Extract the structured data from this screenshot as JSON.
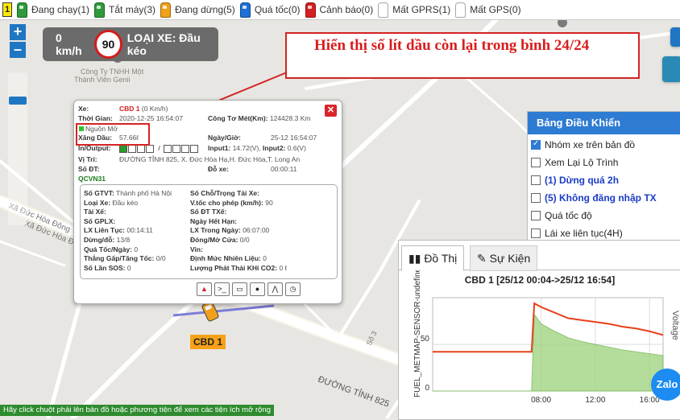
{
  "status_bar": {
    "badge": "1",
    "items": [
      {
        "label": "Đang chạy(1)",
        "color": "#2e9a3c"
      },
      {
        "label": "Tắt máy(3)",
        "color": "#2e9a3c"
      },
      {
        "label": "Đang dừng(5)",
        "color": "#f0a019"
      },
      {
        "label": "Quá tốc(0)",
        "color": "#1e6fd6"
      },
      {
        "label": "Cảnh báo(0)",
        "color": "#d42020"
      },
      {
        "label": "Mất GPRS(1)",
        "color": "#ffffff"
      },
      {
        "label": "Mất GPS(0)",
        "color": "#ffffff"
      }
    ]
  },
  "zoom": {
    "plus": "+",
    "minus": "–"
  },
  "speed_panel": {
    "speed": "0 km/h",
    "limit": "90",
    "vehicle_type": "LOẠI XE: Đầu kéo"
  },
  "annotation": "Hiển thị số lít dầu còn lại trong bình 24/24",
  "map_labels": {
    "company": "Công Ty TNHH Một Thành Viên Genii International",
    "road_1": "ĐƯỜNG TỈNH 825",
    "road_2": "Xã Đức Hòa Đông",
    "road_3": "Xã Đức Hòa Đông",
    "road_4": "Số 3",
    "road_5": "Tỉnh 825",
    "vehicle_label": "CBD 1"
  },
  "popup": {
    "xe_label": "Xe:",
    "xe_value": "CBD 1",
    "speed_value": "(0 Km/h)",
    "thoi_gian_label": "Thời Gian:",
    "thoi_gian_value": "2020-12-25 16:54:07",
    "cong_to_label": "Công Tơ Mét(Km):",
    "cong_to_value": "124428.3 Km",
    "nguon_label": "Nguồn Mở",
    "ngay_gio_label": "Ngày/Giờ:",
    "ngay_gio_value": "25-12 16:54:07",
    "xang_dau_label": "Xăng Dầu:",
    "xang_dau_value": "57.66ℓ",
    "io_label": "In/Output:",
    "input1_label": "Input1:",
    "input1_value": "14.72(V),",
    "input2_label": "Input2:",
    "input2_value": "0.6(V)",
    "vi_tri_label": "Vị Trí:",
    "vi_tri_value": "ĐƯỜNG TỈNH 825, X. Đức Hòa Hạ,H. Đức Hòa,T. Long An",
    "so_dt_label": "Số ĐT:",
    "do_xe_label": "Đỗ xe:",
    "do_xe_value": "00:00:11",
    "plate": "QCVN31",
    "details": [
      {
        "label": "Số GTVT:",
        "value": "Thành phố Hà Nội"
      },
      {
        "label": "Số Chỗ/Trọng Tải Xe:",
        "value": ""
      },
      {
        "label": "Loại Xe:",
        "value": "Đầu kéo"
      },
      {
        "label": "V.tốc cho phép (km/h):",
        "value": "90"
      },
      {
        "label": "Tài Xế:",
        "value": ""
      },
      {
        "label": "Số ĐT TXế:",
        "value": ""
      },
      {
        "label": "Số GPLX:",
        "value": ""
      },
      {
        "label": "Ngày Hết Hạn:",
        "value": ""
      },
      {
        "label": "LX Liên Tục:",
        "value": "00:14:11"
      },
      {
        "label": "LX Trong Ngày:",
        "value": "06:07:00"
      },
      {
        "label": "Dừng/đỗ:",
        "value": "13/8"
      },
      {
        "label": "Đóng/Mở Cửa:",
        "value": "0/0"
      },
      {
        "label": "Quá Tốc/Ngày:",
        "value": "0"
      },
      {
        "label": "Vin:",
        "value": ""
      },
      {
        "label": "Thắng Gấp/Tăng Tốc:",
        "value": "0/0"
      },
      {
        "label": "Định Mức Nhiên Liệu:",
        "value": "0"
      },
      {
        "label": "Số Lần SOS:",
        "value": "0"
      },
      {
        "label": "Lượng Phát Thải KHí CO2:",
        "value": "0 ℓ"
      }
    ]
  },
  "control_panel": {
    "title": "Bảng Điều Khiển",
    "items": [
      {
        "label": "Nhóm xe trên bản đồ",
        "checked": true
      },
      {
        "label": "Xem Lại Lộ Trình",
        "checked": false
      },
      {
        "label": "(1) Dừng quá 2h",
        "checked": false
      },
      {
        "label": "(5) Không đăng nhập TX",
        "checked": false
      },
      {
        "label": "Quá tốc độ",
        "checked": false
      },
      {
        "label": "Lái xe liên tục(4H)",
        "checked": false
      }
    ]
  },
  "chart_panel": {
    "tab_active": "Đồ Thị",
    "tab_inactive": "Sự Kiện"
  },
  "chart_data": {
    "type": "line",
    "title": "CBD 1 [25/12 00:04->25/12 16:54]",
    "ylabel": "FUEL_METMAP-SENSOR-undefined",
    "y2label": "Voltage",
    "yticks": [
      "0",
      "50"
    ],
    "xticks": [
      "08:00",
      "12:00",
      "16:00"
    ],
    "ylim": [
      0,
      100
    ],
    "xlim": [
      0,
      17
    ],
    "series": [
      {
        "values_x": [
          0,
          7.3,
          7.5,
          8,
          9,
          10,
          11,
          12,
          13,
          14,
          15,
          16,
          17
        ],
        "values_y": [
          42,
          42,
          94,
          90,
          84,
          78,
          76,
          74,
          72,
          69,
          67,
          64,
          60
        ],
        "color": "#e8411b"
      },
      {
        "values_x": [
          0,
          7.3,
          7.5,
          8,
          9,
          10,
          11,
          12,
          13,
          14,
          15,
          16,
          17
        ],
        "values_y": [
          0,
          0,
          82,
          72,
          64,
          57,
          53,
          50,
          47,
          44,
          42,
          40,
          38
        ],
        "color": "#9bd27a"
      }
    ]
  },
  "bottom_hint": "Hãy click chuột phải lên bản đồ hoặc phương tiện để xem các tiện ích mở rộng",
  "zalo": "Zalo"
}
